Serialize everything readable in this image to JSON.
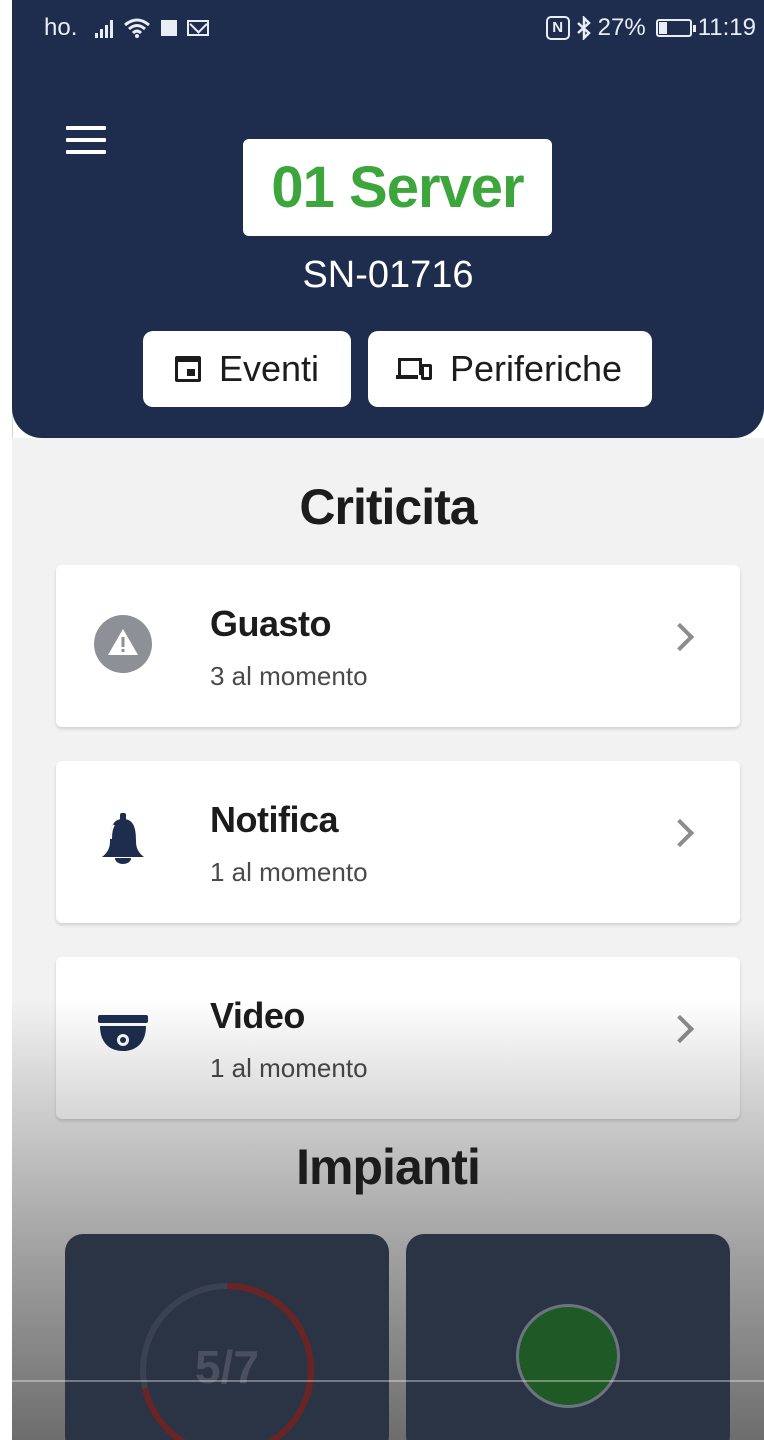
{
  "status_bar": {
    "carrier": "ho.",
    "battery": "27%",
    "time": "11:19"
  },
  "header": {
    "menu_icon": "hamburger-menu-icon",
    "title": "01 Server",
    "serial": "SN-01716",
    "title_color": "#3ca53c",
    "background_color": "#1e2d4e",
    "buttons": [
      {
        "label": "Eventi",
        "icon": "calendar-icon"
      },
      {
        "label": "Periferiche",
        "icon": "devices-icon"
      }
    ]
  },
  "criticita": {
    "title": "Criticita",
    "items": [
      {
        "title": "Guasto",
        "subtitle": "3 al momento",
        "icon": "warning-icon"
      },
      {
        "title": "Notifica",
        "subtitle": "1 al momento",
        "icon": "bell-icon"
      },
      {
        "title": "Video",
        "subtitle": "1 al momento",
        "icon": "camera-icon"
      }
    ]
  },
  "impianti": {
    "title": "Impianti",
    "cards": [
      {
        "label": "5/7",
        "progress": {
          "value": 5,
          "total": 7
        },
        "icon": "progress-ring"
      },
      {
        "icon": "status-dot",
        "status_color": "#1f5a26"
      }
    ]
  }
}
